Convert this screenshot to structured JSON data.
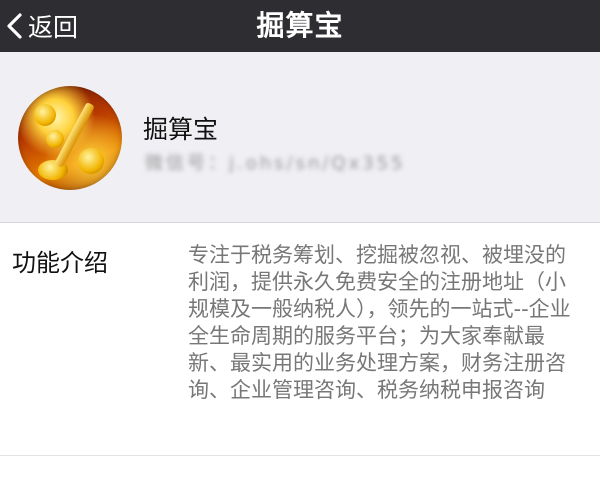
{
  "navbar": {
    "back_label": "返回",
    "title": "掘算宝",
    "background": "#2e2e32"
  },
  "profile": {
    "name": "掘算宝",
    "wechat_id": "微信号：j.ohs/sn/Qx355"
  },
  "info": {
    "label": "功能介绍",
    "description": "专注于税务筹划、挖掘被忽视、被埋没的利润，提供永久免费安全的注册地址（小规模及一般纳税人），领先的一站式--企业全生命周期的服务平台；为大家奉献最新、最实用的业务处理方案，财务注册咨询、企业管理咨询、税务纳税申报咨询"
  }
}
